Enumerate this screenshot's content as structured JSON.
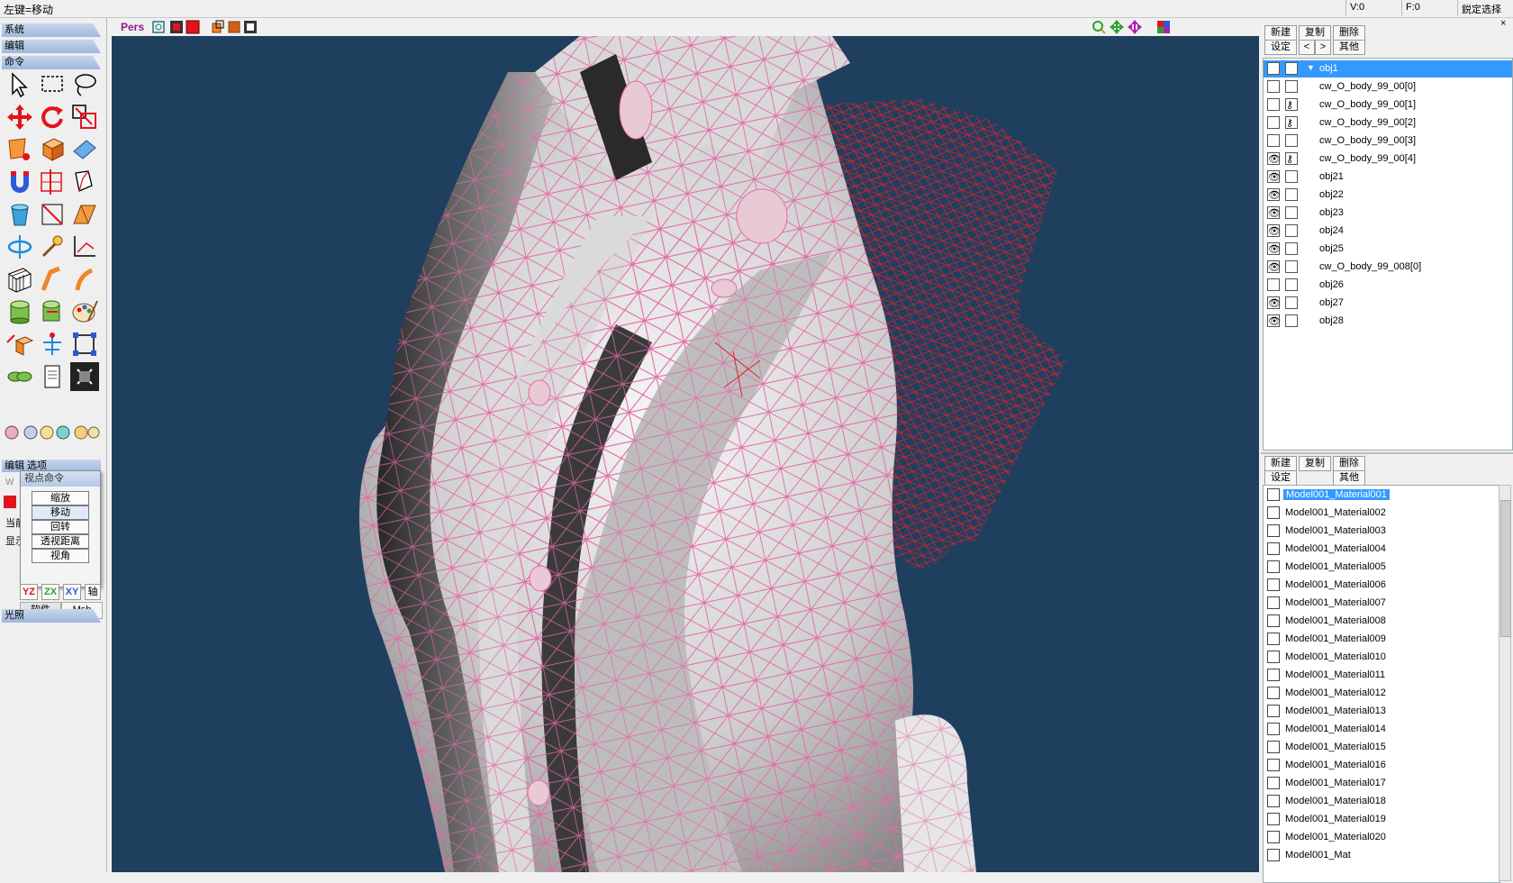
{
  "status": {
    "hint": "左键=移动",
    "v_label": "V:0",
    "f_label": "F:0",
    "right_label": "鋭定选择"
  },
  "left": {
    "sections": [
      "系统",
      "编辑",
      "命令"
    ],
    "edit_option": "编辑 选项",
    "popup": {
      "title": "视点命令",
      "buttons": [
        "缩放",
        "移动",
        "回转",
        "透视距离",
        "视角"
      ]
    },
    "axis": [
      "YZ",
      "ZX",
      "XY",
      "轴"
    ],
    "tabs": [
      "软件",
      "Msh"
    ],
    "light": "光照",
    "side_labels": [
      "W",
      "当前",
      "显示"
    ]
  },
  "viewport": {
    "mode": "Pers",
    "bg_color": "#1f3f5e",
    "wire_color": "#e46aa8",
    "red_wire": "#e0202a"
  },
  "objects": {
    "buttons": [
      "新建",
      "复制",
      "删除",
      "设定",
      "<",
      ">",
      "其他"
    ],
    "items": [
      {
        "name": "obj1",
        "selected": true,
        "visible": false
      },
      {
        "name": "cw_O_body_99_00[0]",
        "visible": false
      },
      {
        "name": "cw_O_body_99_00[1]",
        "visible": false
      },
      {
        "name": "cw_O_body_99_00[2]",
        "visible": false
      },
      {
        "name": "cw_O_body_99_00[3]",
        "visible": false
      },
      {
        "name": "cw_O_body_99_00[4]",
        "visible": true
      },
      {
        "name": "obj21",
        "visible": true
      },
      {
        "name": "obj22",
        "visible": true
      },
      {
        "name": "obj23",
        "visible": true
      },
      {
        "name": "obj24",
        "visible": true
      },
      {
        "name": "obj25",
        "visible": true
      },
      {
        "name": "cw_O_body_99_008[0]",
        "visible": true
      },
      {
        "name": "obj26",
        "visible": false
      },
      {
        "name": "obj27",
        "visible": true
      },
      {
        "name": "obj28",
        "visible": true
      }
    ]
  },
  "materials": {
    "buttons": [
      "新建",
      "复制",
      "删除",
      "设定",
      "其他"
    ],
    "items": [
      "Model001_Material001",
      "Model001_Material002",
      "Model001_Material003",
      "Model001_Material004",
      "Model001_Material005",
      "Model001_Material006",
      "Model001_Material007",
      "Model001_Material008",
      "Model001_Material009",
      "Model001_Material010",
      "Model001_Material011",
      "Model001_Material012",
      "Model001_Material013",
      "Model001_Material014",
      "Model001_Material015",
      "Model001_Material016",
      "Model001_Material017",
      "Model001_Material018",
      "Model001_Material019",
      "Model001_Material020",
      "Model001_Mat"
    ]
  }
}
